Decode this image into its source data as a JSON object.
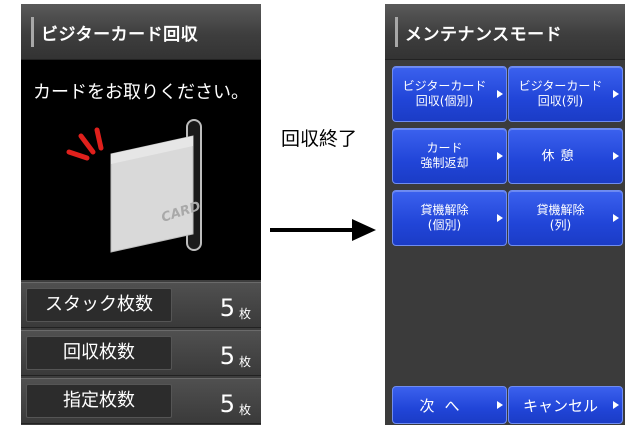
{
  "left_screen": {
    "title": "ビジターカード回収",
    "instruction": "カードをお取りください。",
    "card_text": "CARD",
    "counters": [
      {
        "label": "スタック枚数",
        "value": "5",
        "unit": "枚"
      },
      {
        "label": "回収枚数",
        "value": "5",
        "unit": "枚"
      },
      {
        "label": "指定枚数",
        "value": "5",
        "unit": "枚"
      }
    ]
  },
  "transition": {
    "label": "回収終了",
    "icon": "right-arrow-icon"
  },
  "right_screen": {
    "title": "メンテナンスモード",
    "buttons": [
      {
        "line1": "ビジターカード",
        "line2": "回収(個別)"
      },
      {
        "line1": "ビジターカード",
        "line2": "回収(列)"
      },
      {
        "line1": "カード",
        "line2": "強制返却"
      },
      {
        "line1": "休憩",
        "line2": ""
      },
      {
        "line1": "貸機解除",
        "line2": "(個別)"
      },
      {
        "line1": "貸機解除",
        "line2": "(列)"
      }
    ],
    "next_label": "次へ",
    "cancel_label": "キャンセル"
  },
  "colors": {
    "button_blue": "#2347dc",
    "panel_dark": "#3a3a3a",
    "alert_red": "#e0201c"
  }
}
